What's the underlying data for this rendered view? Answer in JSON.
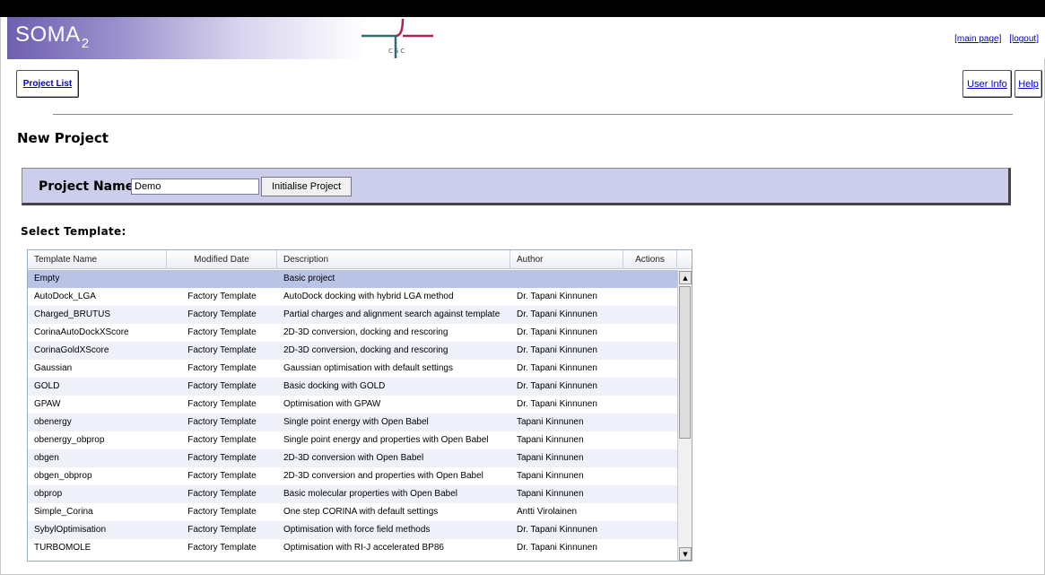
{
  "header": {
    "logo_main": "SOMA",
    "logo_sub": "2",
    "csc_text": "CSC",
    "links": [
      "[main page]",
      "[logout]"
    ]
  },
  "nav": {
    "project_list": "Project List",
    "user_info": "User Info",
    "help": "Help"
  },
  "page_title": "New Project",
  "project": {
    "label": "Project Name:",
    "value": "Demo",
    "init_button": "Initialise Project"
  },
  "select_template_title": "Select Template:",
  "table": {
    "columns": [
      "Template Name",
      "Modified Date",
      "Description",
      "Author",
      "Actions"
    ],
    "rows": [
      [
        "Empty",
        "",
        "Basic project",
        "",
        ""
      ],
      [
        "AutoDock_LGA",
        "Factory Template",
        "AutoDock docking with hybrid LGA method",
        "Dr. Tapani Kinnunen",
        ""
      ],
      [
        "Charged_BRUTUS",
        "Factory Template",
        "Partial charges and alignment search against template",
        "Dr. Tapani Kinnunen",
        ""
      ],
      [
        "CorinaAutoDockXScore",
        "Factory Template",
        "2D-3D conversion, docking and rescoring",
        "Dr. Tapani Kinnunen",
        ""
      ],
      [
        "CorinaGoldXScore",
        "Factory Template",
        "2D-3D conversion, docking and rescoring",
        "Dr. Tapani Kinnunen",
        ""
      ],
      [
        "Gaussian",
        "Factory Template",
        "Gaussian optimisation with default settings",
        "Dr. Tapani Kinnunen",
        ""
      ],
      [
        "GOLD",
        "Factory Template",
        "Basic docking with GOLD",
        "Dr. Tapani Kinnunen",
        ""
      ],
      [
        "GPAW",
        "Factory Template",
        "Optimisation with GPAW",
        "Dr. Tapani Kinnunen",
        ""
      ],
      [
        "obenergy",
        "Factory Template",
        "Single point energy with Open Babel",
        "Tapani Kinnunen",
        ""
      ],
      [
        "obenergy_obprop",
        "Factory Template",
        "Single point energy and properties with Open Babel",
        "Tapani Kinnunen",
        ""
      ],
      [
        "obgen",
        "Factory Template",
        "2D-3D conversion with Open Babel",
        "Tapani Kinnunen",
        ""
      ],
      [
        "obgen_obprop",
        "Factory Template",
        "2D-3D conversion and properties with Open Babel",
        "Tapani Kinnunen",
        ""
      ],
      [
        "obprop",
        "Factory Template",
        "Basic molecular properties with Open Babel",
        "Tapani Kinnunen",
        ""
      ],
      [
        "Simple_Corina",
        "Factory Template",
        "One step CORINA with default settings",
        "Antti Virolainen",
        ""
      ],
      [
        "SybylOptimisation",
        "Factory Template",
        "Optimisation with force field methods",
        "Dr. Tapani Kinnunen",
        ""
      ],
      [
        "TURBOMOLE",
        "Factory Template",
        "Optimisation with RI-J accelerated BP86",
        "Dr. Tapani Kinnunen",
        ""
      ]
    ],
    "selected_row": 0
  },
  "icons": {
    "scroll_up": "▲",
    "scroll_down": "▼"
  },
  "colors": {
    "header_gradient_start": "#6e5fb0",
    "project_bar": "#cccceb",
    "selected_row": "#b9c3e6",
    "alt_row": "#eef0fa",
    "link": "#0000cc",
    "csc_red": "#b0254a",
    "csc_teal": "#2b6e74"
  }
}
